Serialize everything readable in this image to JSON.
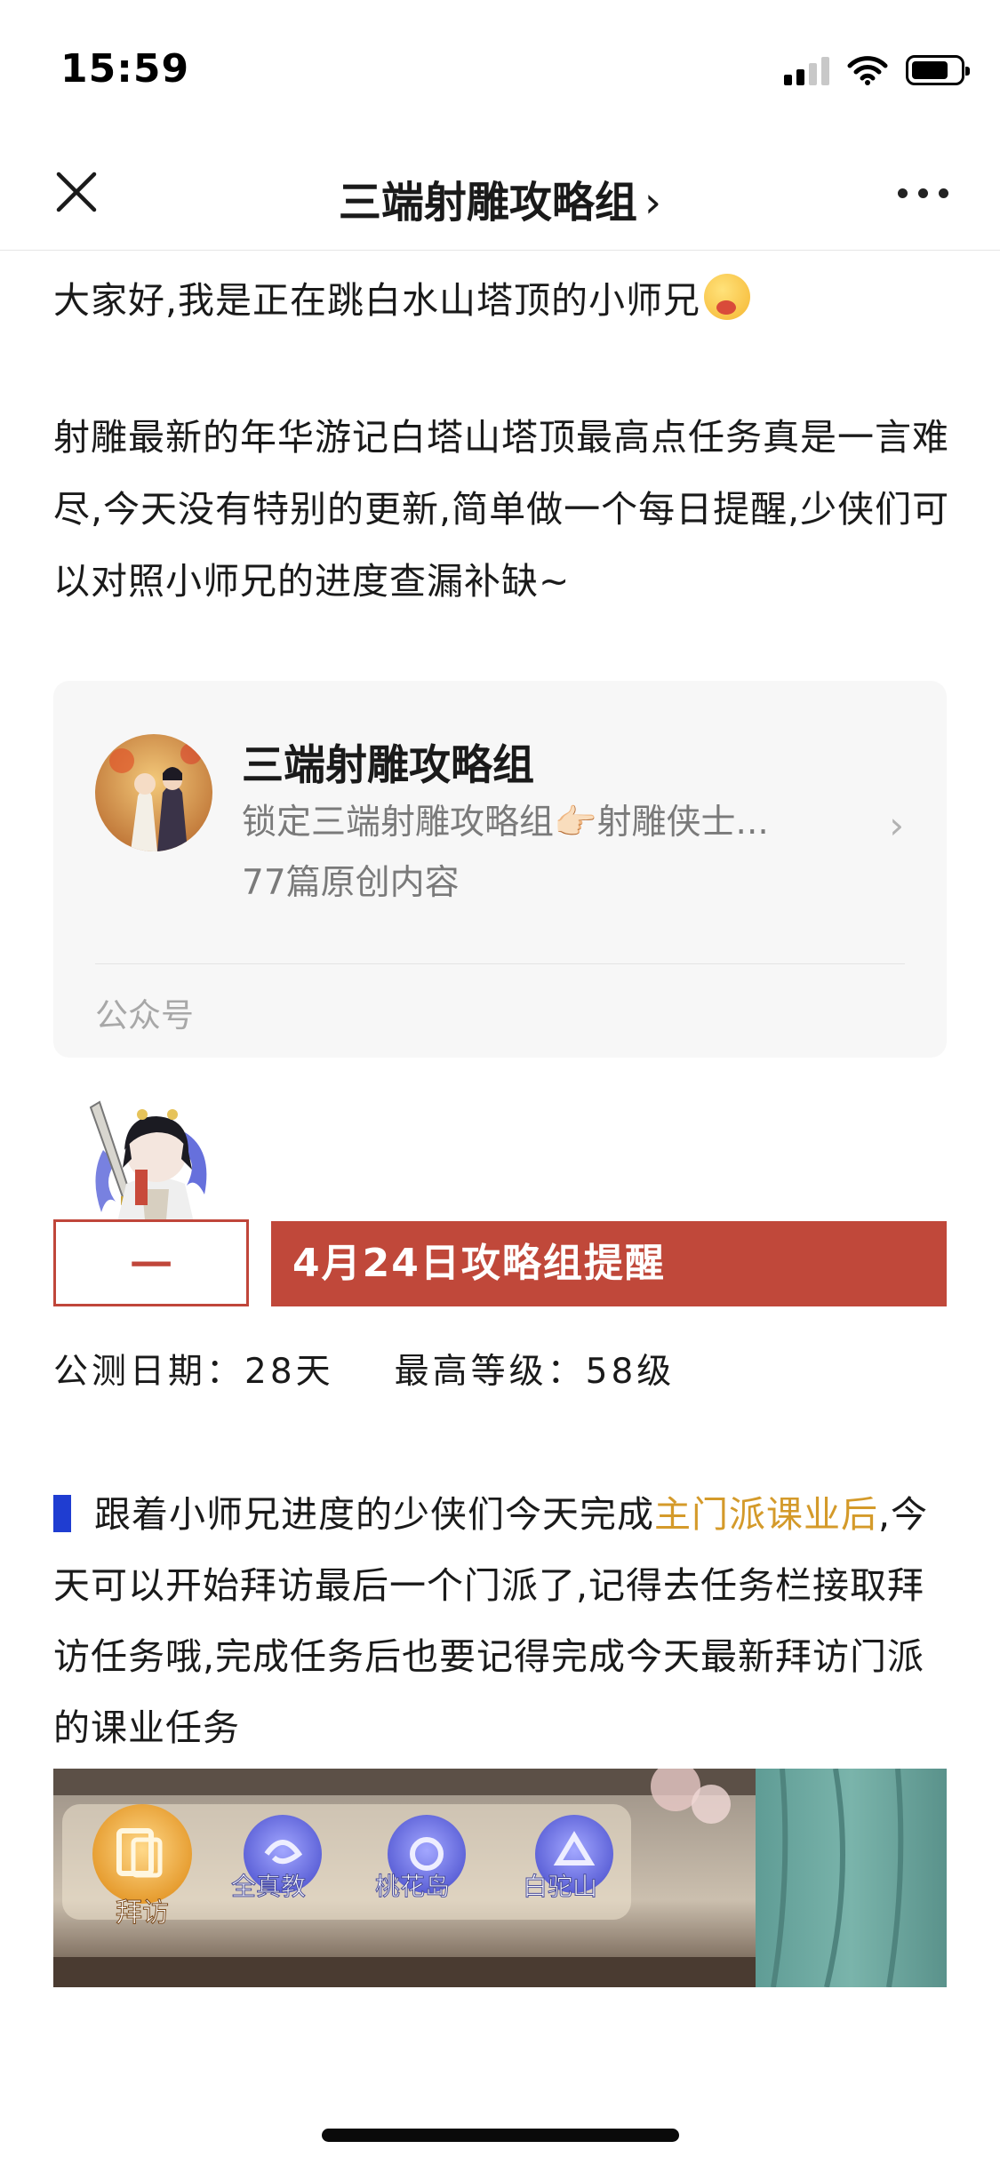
{
  "status_bar": {
    "time": "15:59",
    "icons": [
      "signal-icon",
      "wifi-icon",
      "battery-icon"
    ]
  },
  "nav": {
    "title": "三端射雕攻略组",
    "chevron": "›",
    "close_icon": "close-icon",
    "more_icon": "more-icon"
  },
  "article": {
    "intro": "大家好,我是正在跳白水山塔顶的小师兄",
    "paragraph1": "射雕最新的年华游记白塔山塔顶最高点任务真是一言难尽,今天没有特别的更新,简单做一个每日提醒,少侠们可以对照小师兄的进度查漏补缺~"
  },
  "account_card": {
    "name": "三端射雕攻略组",
    "description": "锁定三端射雕攻略组👉🏻射雕侠士...",
    "count": "77篇原创内容",
    "type": "公众号"
  },
  "banner": {
    "left_label": "一",
    "title": "4月24日攻略组提醒"
  },
  "stats": {
    "launch_label": "公测日期：",
    "launch_value": "28天",
    "level_label": "最高等级：",
    "level_value": "58级"
  },
  "guide": {
    "part1": "跟着小师兄进度的少侠们今天完成",
    "highlight": "主门派课业后",
    "part2": ",今天可以开始拜访最后一个门派了,记得去任务栏接取拜访任务哦,完成任务后也要记得完成今天最新拜访门派的课业任务"
  },
  "game_menu": {
    "items": [
      "拜访",
      "全真教",
      "桃花岛",
      "白驼山"
    ]
  },
  "colors": {
    "banner_red": "#c0483a",
    "highlight_gold": "#d49a2a",
    "marker_blue": "#1f3dd1",
    "card_bg": "#f7f7f7"
  }
}
